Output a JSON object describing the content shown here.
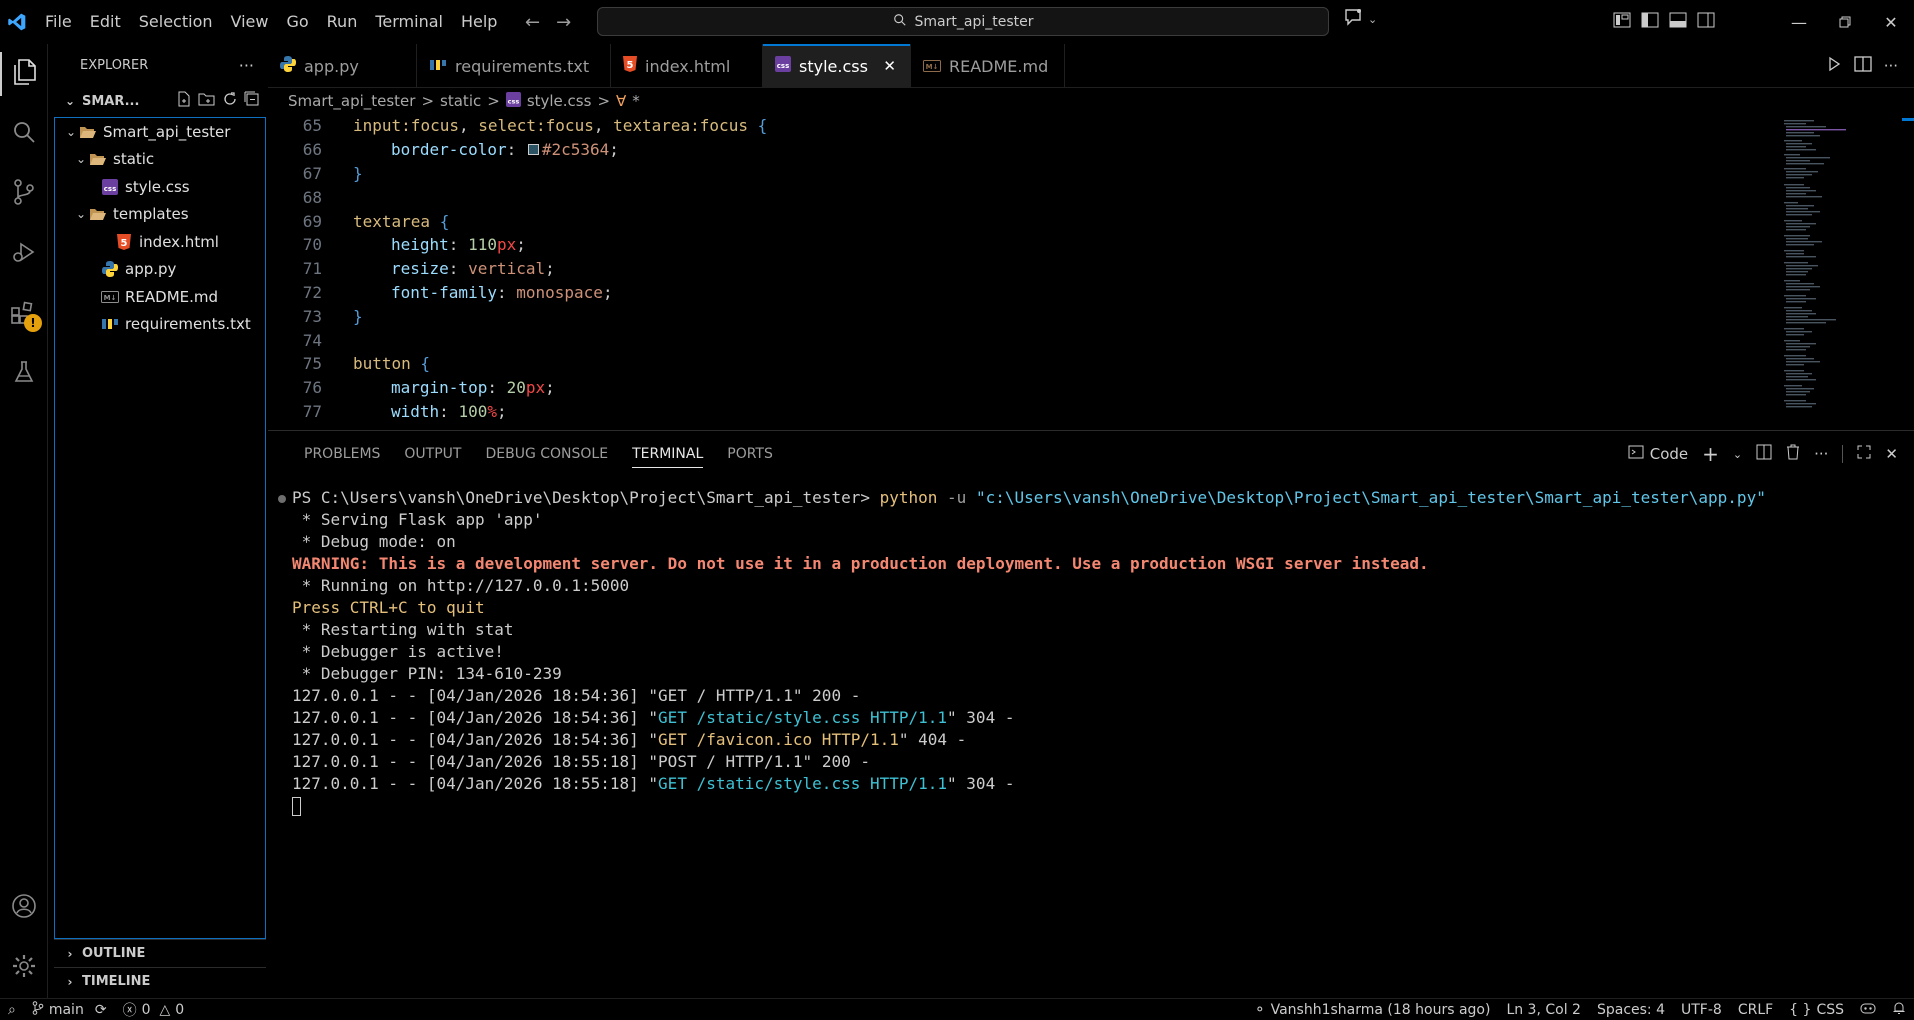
{
  "titlebar": {
    "menu": [
      "File",
      "Edit",
      "Selection",
      "View",
      "Go",
      "Run",
      "Terminal",
      "Help"
    ],
    "search_text": "Smart_api_tester"
  },
  "sidebar": {
    "title": "EXPLORER",
    "workspace": "SMAR...",
    "tree": {
      "root": "Smart_api_tester",
      "static": "static",
      "style_css": "style.css",
      "templates": "templates",
      "index_html": "index.html",
      "app_py": "app.py",
      "readme": "README.md",
      "requirements": "requirements.txt"
    },
    "outline": "OUTLINE",
    "timeline": "TIMELINE"
  },
  "tabs": [
    "app.py",
    "requirements.txt",
    "index.html",
    "style.css",
    "README.md"
  ],
  "breadcrumb": {
    "root": "Smart_api_tester",
    "folder": "static",
    "file": "style.css",
    "symbol": "*",
    "sep": ">"
  },
  "code": {
    "line_numbers": [
      "65",
      "66",
      "67",
      "68",
      "69",
      "70",
      "71",
      "72",
      "73",
      "74",
      "75",
      "76",
      "77"
    ],
    "l65_sel1": "input",
    "l65_ps1": ":focus",
    "l65_c1": ", ",
    "l65_sel2": "select",
    "l65_ps2": ":focus",
    "l65_c2": ", ",
    "l65_sel3": "textarea",
    "l65_ps3": ":focus",
    "l65_brace": " {",
    "l66_prop": "border-color",
    "l66_colon": ": ",
    "l66_val": "#2c5364",
    "l66_semi": ";",
    "l67": "}",
    "l69_sel": "textarea",
    "l69_brace": " {",
    "l70_prop": "height",
    "l70_colon": ": ",
    "l70_num": "110",
    "l70_unit": "px",
    "l70_semi": ";",
    "l71_prop": "resize",
    "l71_colon": ": ",
    "l71_val": "vertical",
    "l71_semi": ";",
    "l72_prop": "font-family",
    "l72_colon": ": ",
    "l72_val": "monospace",
    "l72_semi": ";",
    "l73": "}",
    "l75_sel": "button",
    "l75_brace": " {",
    "l76_prop": "margin-top",
    "l76_colon": ": ",
    "l76_num": "20",
    "l76_unit": "px",
    "l76_semi": ";",
    "l77_prop": "width",
    "l77_colon": ": ",
    "l77_num": "100",
    "l77_unit": "%",
    "l77_semi": ";",
    "swatch_color": "#2c5364"
  },
  "panel": {
    "tabs": [
      "PROBLEMS",
      "OUTPUT",
      "DEBUG CONSOLE",
      "TERMINAL",
      "PORTS"
    ],
    "shell_label": "Code"
  },
  "terminal": {
    "prompt": "PS C:\\Users\\vansh\\OneDrive\\Desktop\\Project\\Smart_api_tester> ",
    "cmd": "python",
    "flag": " -u ",
    "path": "\"c:\\Users\\vansh\\OneDrive\\Desktop\\Project\\Smart_api_tester\\Smart_api_tester\\app.py\"",
    "l1": " * Serving Flask app 'app'",
    "l2": " * Debug mode: on",
    "warning": "WARNING: This is a development server. Do not use it in a production deployment. Use a production WSGI server instead.",
    "l4": " * Running on http://127.0.0.1:5000",
    "l5": "Press CTRL+C to quit",
    "l6": " * Restarting with stat",
    "l7": " * Debugger is active!",
    "l8": " * Debugger PIN: 134-610-239",
    "r1_pre": "127.0.0.1 - - [04/Jan/2026 18:54:36] \"",
    "r1_req": "GET / HTTP/1.1",
    "r1_post": "\" 200 -",
    "r2_pre": "127.0.0.1 - - [04/Jan/2026 18:54:36] \"",
    "r2_req": "GET /static/style.css HTTP/1.1",
    "r2_post": "\" 304 -",
    "r3_pre": "127.0.0.1 - - [04/Jan/2026 18:54:36] \"",
    "r3_req": "GET /favicon.ico HTTP/1.1",
    "r3_post": "\" 404 -",
    "r4_pre": "127.0.0.1 - - [04/Jan/2026 18:55:18] \"",
    "r4_req": "POST / HTTP/1.1",
    "r4_post": "\" 200 -",
    "r5_pre": "127.0.0.1 - - [04/Jan/2026 18:55:18] \"",
    "r5_req": "GET /static/style.css HTTP/1.1",
    "r5_post": "\" 304 -"
  },
  "statusbar": {
    "branch": "main",
    "errors": "0",
    "warnings": "0",
    "blame": "Vanshh1sharma (18 hours ago)",
    "position": "Ln 3, Col 2",
    "spaces": "Spaces: 4",
    "encoding": "UTF-8",
    "eol": "CRLF",
    "language": "CSS",
    "lang_braces": "{ }"
  },
  "colors": {
    "accent": "#0078d4",
    "background": "#000000",
    "warning_badge": "#e5a00d"
  }
}
